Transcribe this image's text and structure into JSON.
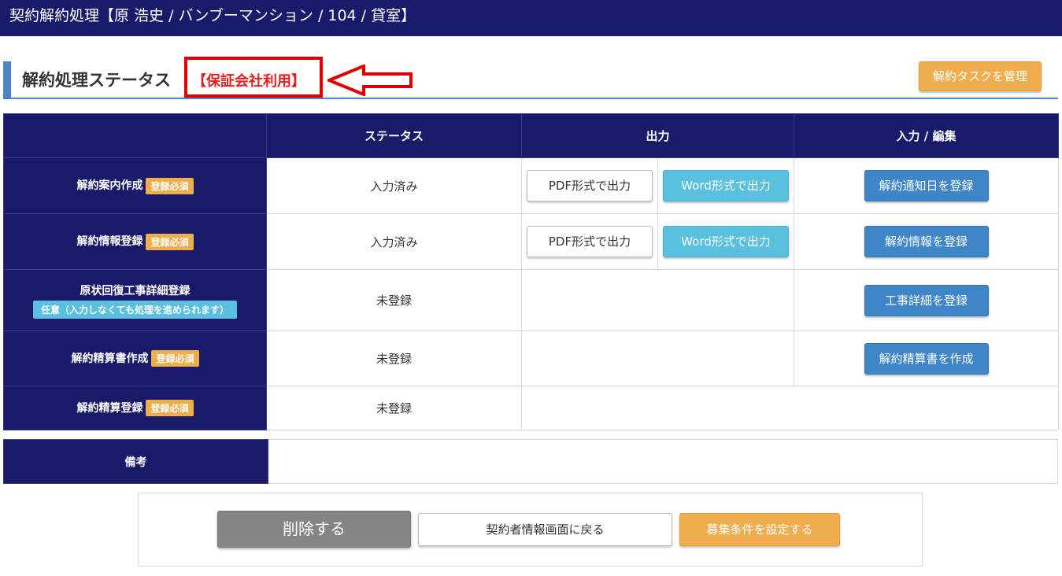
{
  "topbar": {
    "title": "契約解約処理【原 浩史 / バンブーマンション / 104 / 貸室】"
  },
  "section": {
    "title": "解約処理ステータス",
    "guarantee_label": "【保証会社利用】",
    "manage_button": "解約タスクを管理"
  },
  "table": {
    "headers": [
      "",
      "ステータス",
      "出力",
      "入力 / 編集"
    ],
    "rows": [
      {
        "name": "解約案内作成",
        "badge": "登録必須",
        "status": "入力済み",
        "pdf": "PDF形式で出力",
        "word": "Word形式で出力",
        "action": "解約通知日を登録"
      },
      {
        "name": "解約情報登録",
        "badge": "登録必須",
        "status": "入力済み",
        "pdf": "PDF形式で出力",
        "word": "Word形式で出力",
        "action": "解約情報を登録"
      },
      {
        "name": "原状回復工事詳細登録",
        "badge": "任意（入力しなくても処理を進められます）",
        "status": "未登録",
        "action": "工事詳細を登録"
      },
      {
        "name": "解約精算書作成",
        "badge": "登録必須",
        "status": "未登録",
        "action": "解約精算書を作成"
      },
      {
        "name": "解約精算登録",
        "badge": "登録必須",
        "status": "未登録"
      }
    ]
  },
  "notes": {
    "label": "備考",
    "value": ""
  },
  "footer": {
    "delete": "削除する",
    "back": "契約者情報画面に戻る",
    "recruit": "募集条件を設定する"
  },
  "colors": {
    "navy": "#1a1a6b",
    "orange": "#f0ad4e",
    "blue": "#3f86c8",
    "cyan": "#5bc0de",
    "red": "#e00000",
    "gray": "#858585"
  }
}
